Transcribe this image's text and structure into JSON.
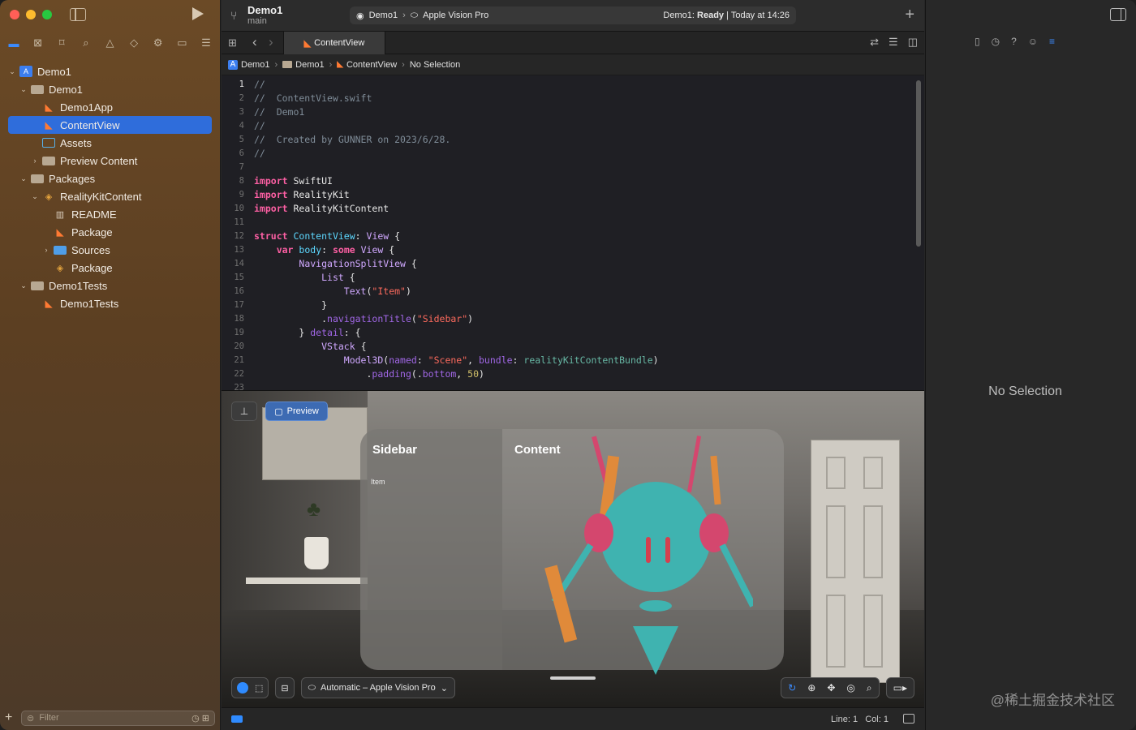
{
  "navigator": {
    "tree": [
      {
        "label": "Demo1",
        "icon": "xcode-project-icon",
        "level": 0,
        "expanded": true,
        "selected": false
      },
      {
        "label": "Demo1",
        "icon": "folder-icon",
        "level": 1,
        "expanded": true,
        "selected": false
      },
      {
        "label": "Demo1App",
        "icon": "swift-file-icon",
        "level": 2,
        "selected": false
      },
      {
        "label": "ContentView",
        "icon": "swift-file-icon",
        "level": 2,
        "selected": true
      },
      {
        "label": "Assets",
        "icon": "asset-catalog-icon",
        "level": 2,
        "selected": false
      },
      {
        "label": "Preview Content",
        "icon": "folder-icon",
        "level": 2,
        "expanded": false,
        "selected": false
      },
      {
        "label": "Packages",
        "icon": "folder-icon",
        "level": 1,
        "expanded": true,
        "selected": false
      },
      {
        "label": "RealityKitContent",
        "icon": "package-icon",
        "level": 2,
        "expanded": true,
        "selected": false
      },
      {
        "label": "README",
        "icon": "book-icon",
        "level": 3,
        "selected": false
      },
      {
        "label": "Package",
        "icon": "swift-file-icon",
        "level": 3,
        "selected": false
      },
      {
        "label": "Sources",
        "icon": "blue-folder-icon",
        "level": 3,
        "expanded": false,
        "selected": false
      },
      {
        "label": "Package",
        "icon": "package-icon",
        "level": 3,
        "selected": false
      },
      {
        "label": "Demo1Tests",
        "icon": "folder-icon",
        "level": 1,
        "expanded": true,
        "selected": false
      },
      {
        "label": "Demo1Tests",
        "icon": "swift-file-icon",
        "level": 2,
        "selected": false
      }
    ],
    "filter_placeholder": "Filter"
  },
  "toolbar": {
    "project": "Demo1",
    "branch": "main",
    "scheme": "Demo1",
    "destination": "Apple Vision Pro",
    "status_target": "Demo1:",
    "status_state": "Ready",
    "status_time": "Today at 14:26"
  },
  "editor": {
    "tab_label": "ContentView",
    "breadcrumb": [
      "Demo1",
      "Demo1",
      "ContentView",
      "No Selection"
    ]
  },
  "code": [
    {
      "n": "1",
      "html": "<span class='cm'>//</span>"
    },
    {
      "n": "2",
      "html": "<span class='cm'>//  ContentView.swift</span>"
    },
    {
      "n": "3",
      "html": "<span class='cm'>//  Demo1</span>"
    },
    {
      "n": "4",
      "html": "<span class='cm'>//</span>"
    },
    {
      "n": "5",
      "html": "<span class='cm'>//  Created by GUNNER on 2023/6/28.</span>"
    },
    {
      "n": "6",
      "html": "<span class='cm'>//</span>"
    },
    {
      "n": "7",
      "html": ""
    },
    {
      "n": "8",
      "html": "<span class='kw'>import</span> <span class='pl'>SwiftUI</span>"
    },
    {
      "n": "9",
      "html": "<span class='kw'>import</span> <span class='pl'>RealityKit</span>"
    },
    {
      "n": "10",
      "html": "<span class='kw'>import</span> <span class='pl'>RealityKitContent</span>"
    },
    {
      "n": "11",
      "html": ""
    },
    {
      "n": "12",
      "html": "<span class='kw'>struct</span> <span class='tyd'>ContentView</span><span class='pl'>: </span><span class='ty'>View</span><span class='pl'> {</span>"
    },
    {
      "n": "13",
      "html": "    <span class='kw'>var</span> <span class='tyd'>body</span><span class='pl'>: </span><span class='kw'>some</span> <span class='ty'>View</span><span class='pl'> {</span>"
    },
    {
      "n": "14",
      "html": "        <span class='ty'>NavigationSplitView</span><span class='pl'> {</span>"
    },
    {
      "n": "15",
      "html": "            <span class='ty'>List</span><span class='pl'> {</span>"
    },
    {
      "n": "16",
      "html": "                <span class='ty'>Text</span><span class='pl'>(</span><span class='st'>\"Item\"</span><span class='pl'>)</span>"
    },
    {
      "n": "17",
      "html": "            <span class='pl'>}</span>"
    },
    {
      "n": "18",
      "html": "            <span class='pl'>.</span><span class='fn'>navigationTitle</span><span class='pl'>(</span><span class='st'>\"Sidebar\"</span><span class='pl'>)</span>"
    },
    {
      "n": "19",
      "html": "        <span class='pl'>} </span><span class='fn'>detail</span><span class='pl'>: {</span>"
    },
    {
      "n": "20",
      "html": "            <span class='ty'>VStack</span><span class='pl'> {</span>"
    },
    {
      "n": "21",
      "html": "                <span class='ty'>Model3D</span><span class='pl'>(</span><span class='fn'>named</span><span class='pl'>: </span><span class='st'>\"Scene\"</span><span class='pl'>, </span><span class='fn'>bundle</span><span class='pl'>: </span><span class='pr'>realityKitContentBundle</span><span class='pl'>)</span>"
    },
    {
      "n": "22",
      "html": "                    <span class='pl'>.</span><span class='fn'>padding</span><span class='pl'>(.</span><span class='fn'>bottom</span><span class='pl'>, </span><span class='nu'>50</span><span class='pl'>)</span>"
    },
    {
      "n": "23",
      "html": ""
    }
  ],
  "canvas": {
    "preview_label": "Preview",
    "sidebar_title": "Sidebar",
    "sidebar_item": "Item",
    "content_title": "Content",
    "device_label": "Automatic – Apple Vision Pro"
  },
  "statusbar": {
    "line": "Line: 1",
    "col": "Col: 1"
  },
  "inspector": {
    "empty_label": "No Selection"
  },
  "watermark": "@稀土掘金技术社区",
  "colors": {
    "accent": "#2f6ddb",
    "navigator_bg": "#5c3f22",
    "editor_bg": "#1f1f24",
    "preview_button": "#3d6bb3"
  }
}
